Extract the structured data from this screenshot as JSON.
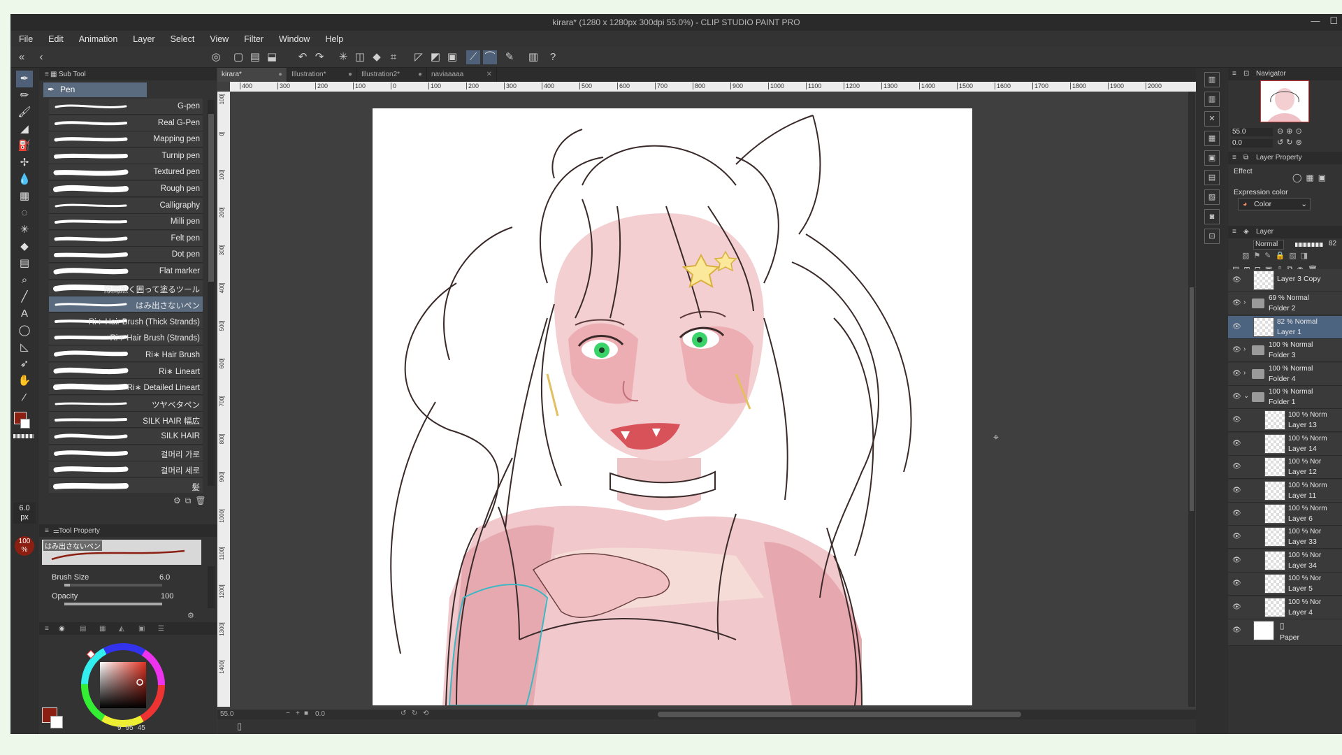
{
  "window": {
    "title": "kirara* (1280 x 1280px 300dpi 55.0%) - CLIP STUDIO PAINT PRO"
  },
  "menu": [
    "File",
    "Edit",
    "Animation",
    "Layer",
    "Select",
    "View",
    "Filter",
    "Window",
    "Help"
  ],
  "sub_tool": {
    "header": "Sub Tool",
    "active_group": "Pen",
    "brushes": [
      {
        "label": "G-pen"
      },
      {
        "label": "Real G-Pen"
      },
      {
        "label": "Mapping pen"
      },
      {
        "label": "Turnip pen"
      },
      {
        "label": "Textured pen"
      },
      {
        "label": "Rough pen"
      },
      {
        "label": "Calligraphy"
      },
      {
        "label": "Milli pen"
      },
      {
        "label": "Felt pen"
      },
      {
        "label": "Dot pen"
      },
      {
        "label": "Flat marker"
      },
      {
        "label": "隙間無く囲って塗るツール"
      },
      {
        "label": "はみ出さないペン"
      },
      {
        "label": "Ri∗ Hair Brush (Thick Strands)"
      },
      {
        "label": "Ri∗ Hair Brush (Strands)"
      },
      {
        "label": "Ri∗ Hair Brush"
      },
      {
        "label": "Ri∗ Lineart"
      },
      {
        "label": "Ri∗ Detailed Lineart"
      },
      {
        "label": "ツヤベタペン"
      },
      {
        "label": "SILK HAIR 幅広"
      },
      {
        "label": "SILK HAIR"
      },
      {
        "label": "걸머리 가로"
      },
      {
        "label": "걸머리 세로"
      },
      {
        "label": "髪"
      }
    ],
    "selected_index": 12
  },
  "tool_property": {
    "header": "Tool Property",
    "preset_name": "はみ出さないペン",
    "brush_size_label": "Brush Size",
    "brush_size_value": "6.0",
    "opacity_label": "Opacity",
    "opacity_value": "100"
  },
  "color_panel": {
    "size_readout": "6.0",
    "size_unit": "px",
    "opacity_readout": "100",
    "opacity_unit": "%",
    "hsv_values": [
      "9",
      "95",
      "45"
    ],
    "main_color": "#8a1f12",
    "sub_color": "#ffffff"
  },
  "canvas": {
    "tabs": [
      "kirara*",
      "Illustration*",
      "Illustration2*",
      "naviaaaaa"
    ],
    "active_tab": 0,
    "ruler_ticks": [
      "400",
      "300",
      "200",
      "100",
      "0",
      "100",
      "200",
      "300",
      "400",
      "500",
      "600",
      "700",
      "800",
      "900",
      "1000",
      "1100",
      "1200",
      "1300",
      "1400",
      "1500",
      "1600",
      "1700",
      "1800",
      "1900",
      "2000"
    ],
    "ruler_v_ticks": [
      "100",
      "0",
      "100",
      "200",
      "300",
      "400",
      "500",
      "600",
      "700",
      "800",
      "900",
      "1000",
      "1100",
      "1200",
      "1300",
      "1400"
    ],
    "zoom": "55.0",
    "rotation": "0.0"
  },
  "navigator": {
    "header": "Navigator",
    "zoom": "55.0",
    "rotation": "0.0"
  },
  "layer_property": {
    "header": "Layer Property",
    "effect_label": "Effect",
    "expression_label": "Expression color",
    "expression_value": "Color"
  },
  "layers_panel": {
    "header": "Layer",
    "blend_mode": "Normal",
    "opacity": "82",
    "layers": [
      {
        "mode": "",
        "name": "Layer 3 Copy",
        "type": "layer"
      },
      {
        "mode": "69 % Normal",
        "name": "Folder 2",
        "type": "folder"
      },
      {
        "mode": "82 % Normal",
        "name": "Layer 1",
        "type": "layer",
        "selected": true
      },
      {
        "mode": "100 % Normal",
        "name": "Folder 3",
        "type": "folder"
      },
      {
        "mode": "100 % Normal",
        "name": "Folder 4",
        "type": "folder"
      },
      {
        "mode": "100 % Normal",
        "name": "Folder 1",
        "type": "folder"
      },
      {
        "mode": "100 % Norm",
        "name": "Layer 13",
        "type": "layer"
      },
      {
        "mode": "100 % Norm",
        "name": "Layer 14",
        "type": "layer"
      },
      {
        "mode": "100 % Nor",
        "name": "Layer 12",
        "type": "layer"
      },
      {
        "mode": "100 % Norm",
        "name": "Layer 11",
        "type": "layer"
      },
      {
        "mode": "100 % Norm",
        "name": "Layer 6",
        "type": "layer"
      },
      {
        "mode": "100 % Nor",
        "name": "Layer 33",
        "type": "layer"
      },
      {
        "mode": "100 % Nor",
        "name": "Layer 34",
        "type": "layer"
      },
      {
        "mode": "100 % Nor",
        "name": "Layer 5",
        "type": "layer"
      },
      {
        "mode": "100 % Nor",
        "name": "Layer 4",
        "type": "layer"
      },
      {
        "mode": "",
        "name": "Paper",
        "type": "paper"
      }
    ]
  }
}
